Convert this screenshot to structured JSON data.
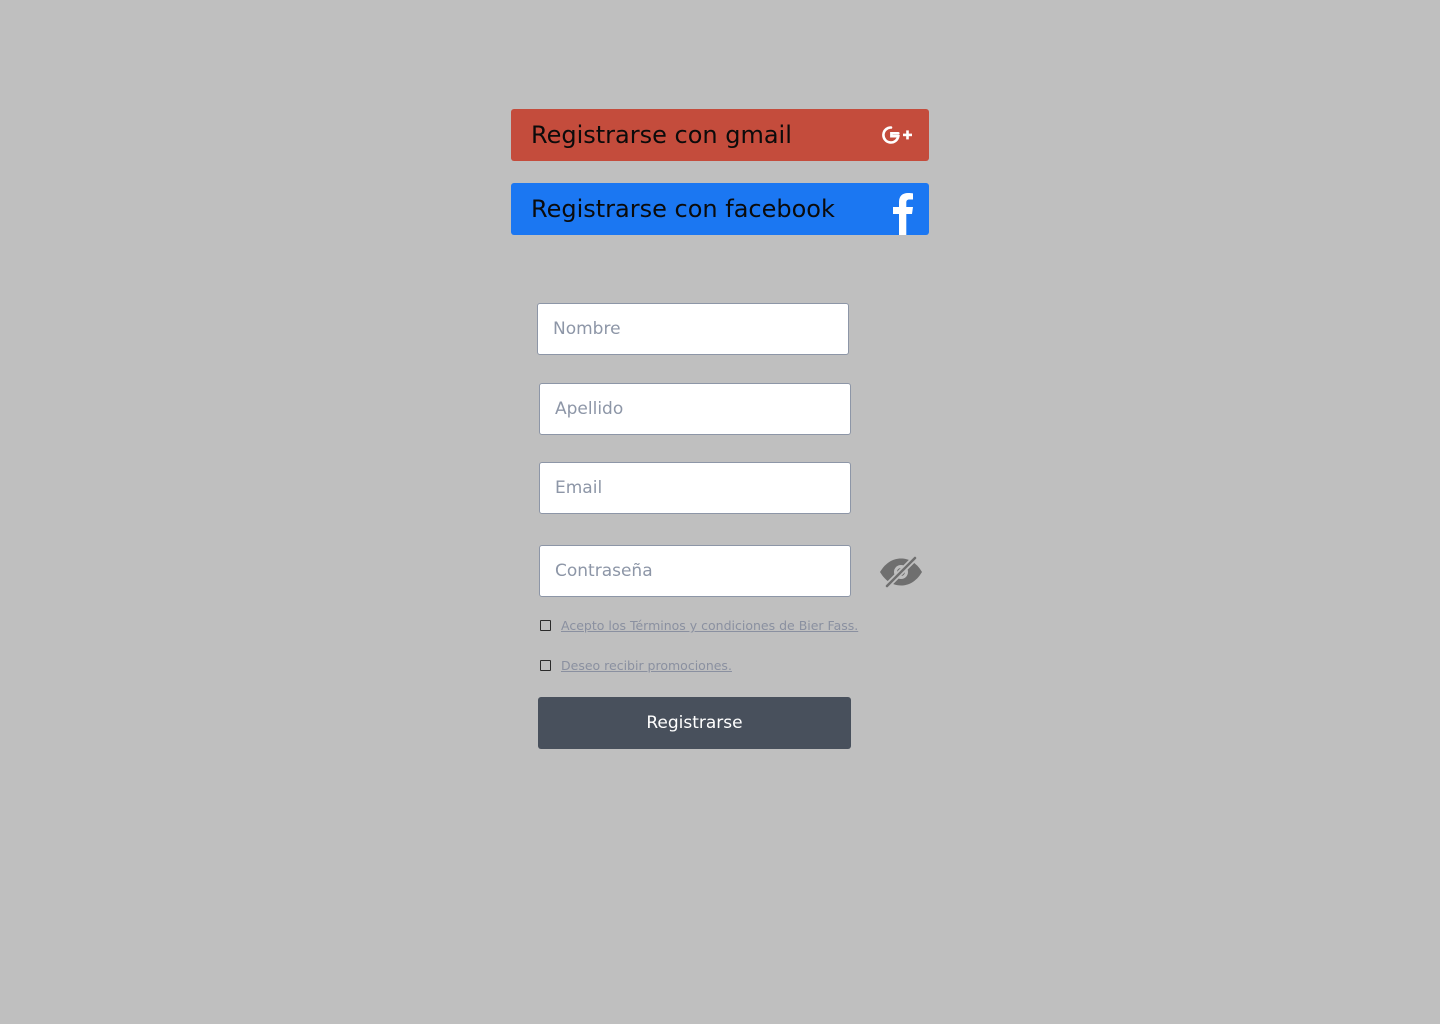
{
  "social": {
    "gmail": {
      "label": "Registrarse con gmail",
      "icon": "google-plus-icon",
      "color": "#c44c3c"
    },
    "facebook": {
      "label": "Registrarse con facebook",
      "icon": "facebook-icon",
      "color": "#1b77f2"
    }
  },
  "form": {
    "nombre": {
      "placeholder": "Nombre",
      "value": ""
    },
    "apellido": {
      "placeholder": "Apellido",
      "value": ""
    },
    "email": {
      "placeholder": "Email",
      "value": ""
    },
    "password": {
      "placeholder": "Contraseña",
      "value": "",
      "toggle_icon": "eye-slash-icon"
    },
    "terms": {
      "label": "Acepto los Términos y condiciones de Bier Fass.",
      "checked": false
    },
    "promo": {
      "label": "Deseo recibir promociones.",
      "checked": false
    },
    "submit_label": "Registrarse"
  },
  "colors": {
    "background": "#bfbfbf",
    "submit": "#48505c",
    "placeholder": "#8d96a7"
  }
}
